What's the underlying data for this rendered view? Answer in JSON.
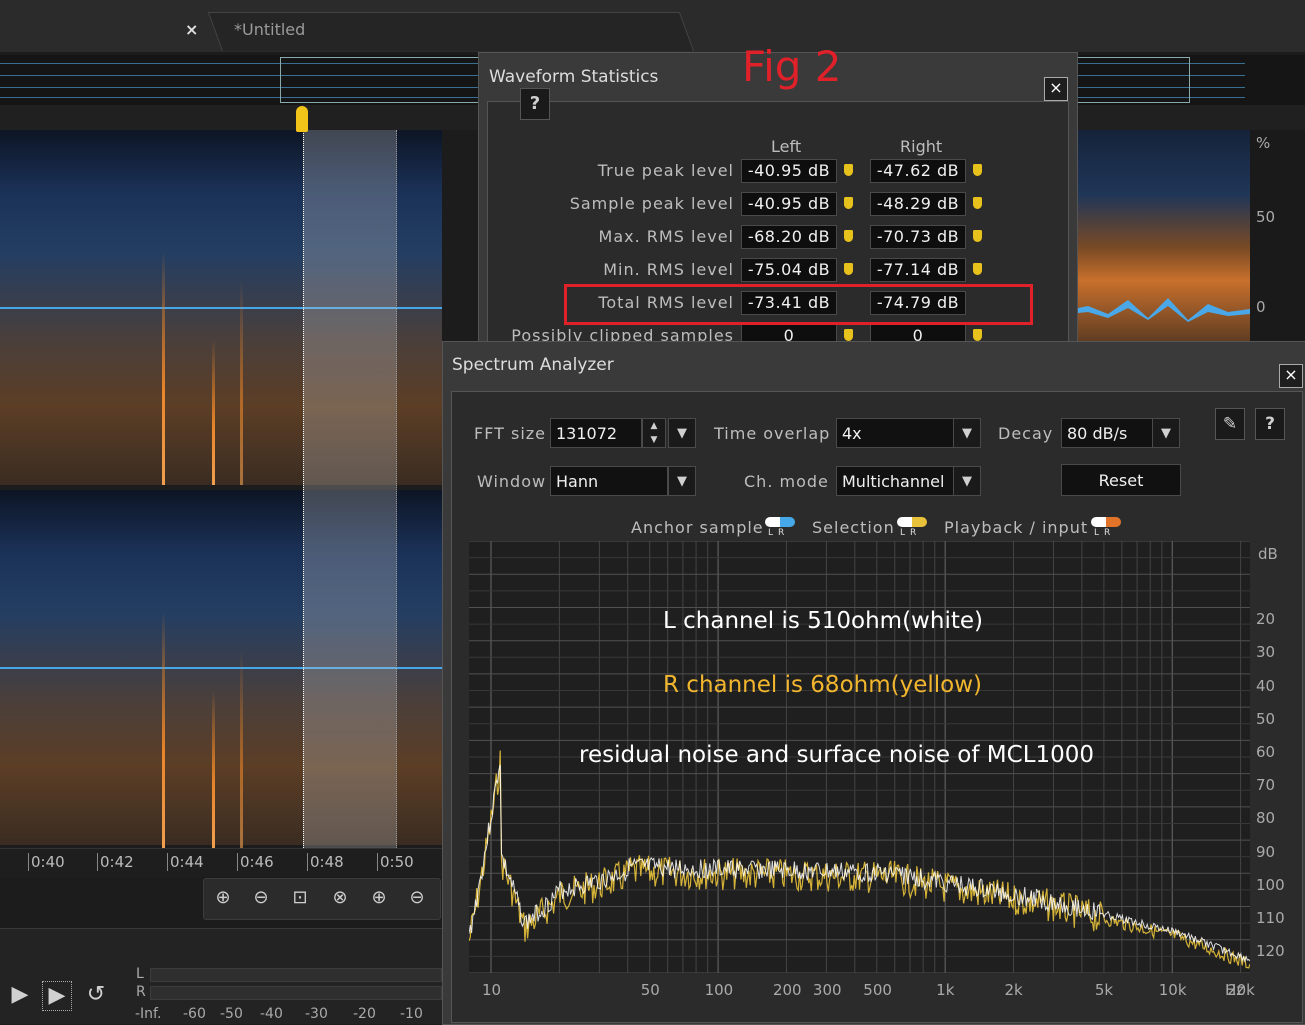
{
  "editor": {
    "tab_close": "×",
    "tab_title": "*Untitled",
    "timeline_labels": [
      "0:40",
      "0:42",
      "0:44",
      "0:46",
      "0:48",
      "0:50"
    ],
    "right_axis_labels": [
      "%",
      "50",
      "0"
    ],
    "meter_channels": [
      "L",
      "R"
    ],
    "meter_scale": [
      "-Inf.",
      "-60",
      "-50",
      "-40",
      "-30",
      "-20",
      "-10"
    ]
  },
  "annotation_fig": "Fig 2",
  "waveform_statistics": {
    "title": "Waveform Statistics",
    "close": "×",
    "help": "?",
    "col_left": "Left",
    "col_right": "Right",
    "rows": [
      {
        "label": "True peak level",
        "left": "-40.95 dB",
        "right": "-47.62 dB"
      },
      {
        "label": "Sample peak level",
        "left": "-40.95 dB",
        "right": "-48.29 dB"
      },
      {
        "label": "Max. RMS level",
        "left": "-68.20 dB",
        "right": "-70.73 dB"
      },
      {
        "label": "Min. RMS level",
        "left": "-75.04 dB",
        "right": "-77.14 dB"
      },
      {
        "label": "Total RMS level",
        "left": "-73.41 dB",
        "right": "-74.79 dB"
      },
      {
        "label": "Possibly clipped samples",
        "left": "0",
        "right": "0"
      }
    ],
    "highlight_color": "#e0212a"
  },
  "spectrum_analyzer": {
    "title": "Spectrum Analyzer",
    "close": "×",
    "fft_label": "FFT size",
    "fft_value": "131072",
    "overlap_label": "Time overlap",
    "overlap_value": "4x",
    "decay_label": "Decay",
    "decay_value": "80 dB/s",
    "window_label": "Window",
    "window_value": "Hann",
    "chmode_label": "Ch. mode",
    "chmode_value": "Multichannel",
    "reset_label": "Reset",
    "legend": [
      {
        "label": "Anchor sample",
        "left_color": "#ffffff",
        "right_color": "#46a8e8"
      },
      {
        "label": "Selection",
        "left_color": "#ffffff",
        "right_color": "#e8c23a"
      },
      {
        "label": "Playback / input",
        "left_color": "#ffffff",
        "right_color": "#e2742a"
      }
    ],
    "lr_text": "LR",
    "db_unit": "dB",
    "db_ticks": [
      "20",
      "30",
      "40",
      "50",
      "60",
      "70",
      "80",
      "90",
      "100",
      "110",
      "120"
    ],
    "freq_ticks": [
      "10",
      "50",
      "100",
      "200",
      "300",
      "500",
      "1k",
      "2k",
      "5k",
      "10k",
      "20k"
    ],
    "freq_unit": "Hz",
    "annotations": {
      "line1": "L channel is 510ohm(white)",
      "line2": "R channel is 68ohm(yellow)",
      "line3": "residual noise and surface noise of MCL1000"
    },
    "colors": {
      "left_trace": "#ffffff",
      "right_trace": "#e8c23a",
      "annotation_yellow": "#f2b62e"
    }
  }
}
